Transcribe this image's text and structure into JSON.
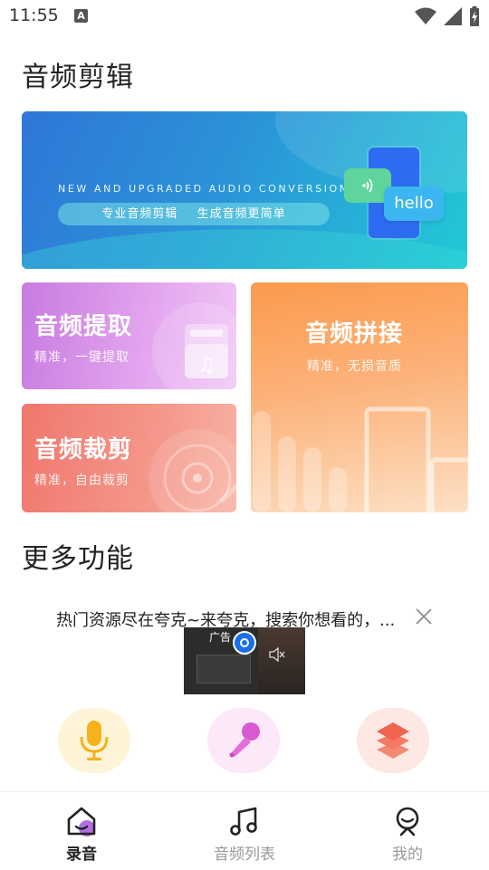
{
  "status_bar": {
    "time": "11:55",
    "notif_glyph": "A"
  },
  "page_title": "音频剪辑",
  "banner": {
    "en_text": "NEW AND UPGRADED AUDIO CONVERSION",
    "pill_left": "专业音频剪辑",
    "pill_right": "生成音频更简单",
    "bubble_text": "hello"
  },
  "cards": {
    "extract": {
      "title": "音频提取",
      "subtitle": "精准，一键提取"
    },
    "cut": {
      "title": "音频裁剪",
      "subtitle": "精准，自由裁剪"
    },
    "join": {
      "title": "音频拼接",
      "subtitle": "精准，无损音质"
    }
  },
  "more_section_title": "更多功能",
  "ad": {
    "text": "热门资源尽在夸克~来夸克，搜索你想看的，...",
    "label": "广告"
  },
  "tabs": [
    {
      "label": "录音",
      "active": true
    },
    {
      "label": "音频列表",
      "active": false
    },
    {
      "label": "我的",
      "active": false
    }
  ],
  "colors": {
    "accent": "#b06ee0",
    "banner_start": "#2f76d8",
    "banner_end": "#22c9d6",
    "extract_card": "#c77be0",
    "cut_card": "#f0776d",
    "join_card": "#fb9a4d"
  }
}
